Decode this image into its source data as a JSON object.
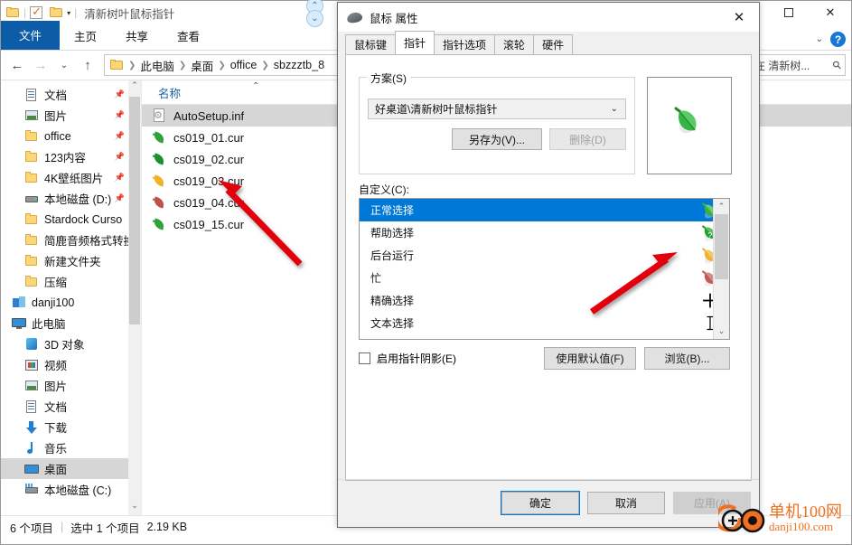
{
  "explorer": {
    "title": "清新树叶鼠标指针",
    "quick_access": [
      "folder-icon",
      "properties-checkbox-icon",
      "new-folder-icon",
      "dropdown-caret-icon"
    ],
    "window_buttons": {
      "minimize": "",
      "maximize": "▫",
      "close": "✕"
    },
    "ribbon_tabs": [
      {
        "label": "文件",
        "active": true
      },
      {
        "label": "主页",
        "active": false
      },
      {
        "label": "共享",
        "active": false
      },
      {
        "label": "查看",
        "active": false
      }
    ],
    "ribbon_help": "?",
    "nav": {
      "back": "←",
      "forward": "→",
      "recent": "⌄",
      "up": "↑"
    },
    "breadcrumb": [
      "此电脑",
      "桌面",
      "office",
      "sbzzztb_8"
    ],
    "search": {
      "value": "在 清新树...",
      "icon": "search-icon"
    },
    "nav_pane": [
      {
        "label": "文档",
        "icon": "document-icon",
        "indent": 1,
        "pin": true
      },
      {
        "label": "图片",
        "icon": "pictures-icon",
        "indent": 1,
        "pin": true
      },
      {
        "label": "office",
        "icon": "folder-icon",
        "indent": 1,
        "pin": true
      },
      {
        "label": "123内容",
        "icon": "folder-icon",
        "indent": 1,
        "pin": true
      },
      {
        "label": "4K壁纸图片",
        "icon": "folder-icon",
        "indent": 1,
        "pin": true
      },
      {
        "label": "本地磁盘 (D:)",
        "icon": "disk-icon",
        "indent": 1,
        "pin": true
      },
      {
        "label": "Stardock Curso",
        "icon": "folder-icon",
        "indent": 1,
        "pin": false
      },
      {
        "label": "简鹿音频格式转换",
        "icon": "folder-icon",
        "indent": 1,
        "pin": false
      },
      {
        "label": "新建文件夹",
        "icon": "folder-icon",
        "indent": 1,
        "pin": false
      },
      {
        "label": "压缩",
        "icon": "folder-icon",
        "indent": 1,
        "pin": false
      },
      {
        "label": "danji100",
        "icon": "onedrive-icon",
        "indent": 0,
        "pin": false
      },
      {
        "label": "此电脑",
        "icon": "this-pc-icon",
        "indent": 0,
        "pin": false
      },
      {
        "label": "3D 对象",
        "icon": "3d-objects-icon",
        "indent": 1,
        "pin": false
      },
      {
        "label": "视频",
        "icon": "videos-icon",
        "indent": 1,
        "pin": false
      },
      {
        "label": "图片",
        "icon": "pictures-icon",
        "indent": 1,
        "pin": false
      },
      {
        "label": "文档",
        "icon": "document-icon",
        "indent": 1,
        "pin": false
      },
      {
        "label": "下载",
        "icon": "downloads-icon",
        "indent": 1,
        "pin": false
      },
      {
        "label": "音乐",
        "icon": "music-icon",
        "indent": 1,
        "pin": false
      },
      {
        "label": "桌面",
        "icon": "desktop-icon",
        "indent": 1,
        "pin": false,
        "highlight": true
      },
      {
        "label": "本地磁盘 (C:)",
        "icon": "disk-c-icon",
        "indent": 1,
        "pin": false
      }
    ],
    "column_header": "名称",
    "files": [
      {
        "name": "AutoSetup.inf",
        "icon": "inf-file-icon",
        "selected": true,
        "color": ""
      },
      {
        "name": "cs019_01.cur",
        "icon": "cursor-leaf-icon",
        "selected": false,
        "color": "#2fa33a"
      },
      {
        "name": "cs019_02.cur",
        "icon": "cursor-leaf-icon",
        "selected": false,
        "color": "#18922c"
      },
      {
        "name": "cs019_03.cur",
        "icon": "cursor-leaf-icon",
        "selected": false,
        "color": "#f0b323"
      },
      {
        "name": "cs019_04.cur",
        "icon": "cursor-leaf-icon",
        "selected": false,
        "color": "#c0504d"
      },
      {
        "name": "cs019_15.cur",
        "icon": "cursor-leaf-icon",
        "selected": false,
        "color": "#2fa33a"
      }
    ],
    "status": {
      "items": "6 个项目",
      "selected": "选中 1 个项目",
      "size": "2.19 KB"
    }
  },
  "dialog": {
    "title": "鼠标 属性",
    "close_label": "✕",
    "tabs": [
      {
        "label": "鼠标键",
        "active": false
      },
      {
        "label": "指针",
        "active": true
      },
      {
        "label": "指针选项",
        "active": false
      },
      {
        "label": "滚轮",
        "active": false
      },
      {
        "label": "硬件",
        "active": false
      }
    ],
    "scheme": {
      "group_label": "方案(S)",
      "value": "好桌道\\清新树叶鼠标指针",
      "caret": "⌄",
      "save_as_label": "另存为(V)...",
      "delete_label": "删除(D)"
    },
    "customize_label": "自定义(C):",
    "cursor_list": [
      {
        "label": "正常选择",
        "selected": true,
        "cursor": "leaf-green-arrow-cursor",
        "color": "#35b33f"
      },
      {
        "label": "帮助选择",
        "selected": false,
        "cursor": "leaf-green-help-cursor",
        "color": "#1fa32e"
      },
      {
        "label": "后台运行",
        "selected": false,
        "cursor": "leaf-yellow-working-cursor",
        "color": "#f2b233"
      },
      {
        "label": "忙",
        "selected": false,
        "cursor": "leaf-red-busy-cursor",
        "color": "#c55a5a"
      },
      {
        "label": "精确选择",
        "selected": false,
        "cursor": "crosshair-cursor",
        "color": "#000000"
      },
      {
        "label": "文本选择",
        "selected": false,
        "cursor": "ibeam-cursor",
        "color": "#000000"
      }
    ],
    "scroll_up": "⌃",
    "scroll_down": "⌄",
    "enable_shadow_label": "启用指针阴影(E)",
    "enable_shadow_checked": false,
    "use_default_label": "使用默认值(F)",
    "browse_label": "浏览(B)...",
    "ok_label": "确定",
    "cancel_label": "取消",
    "apply_label": "应用(A)"
  },
  "watermark": {
    "line1": "单机100网",
    "line2": "danji100.com",
    "color": "#f07020"
  }
}
